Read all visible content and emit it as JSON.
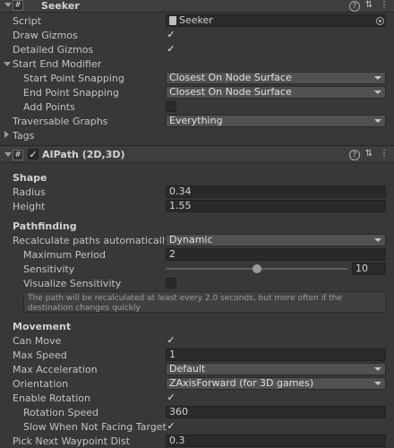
{
  "seeker": {
    "title": "Seeker",
    "script_label": "Script",
    "script_value": "Seeker",
    "draw_gizmos_label": "Draw Gizmos",
    "draw_gizmos": true,
    "detailed_gizmos_label": "Detailed Gizmos",
    "detailed_gizmos": true,
    "start_end_modifier_label": "Start End Modifier",
    "start_point_snapping_label": "Start Point Snapping",
    "start_point_snapping_value": "Closest On Node Surface",
    "end_point_snapping_label": "End Point Snapping",
    "end_point_snapping_value": "Closest On Node Surface",
    "add_points_label": "Add Points",
    "add_points": false,
    "traversable_graphs_label": "Traversable Graphs",
    "traversable_graphs_value": "Everything",
    "tags_label": "Tags"
  },
  "aipath": {
    "title": "AIPath (2D,3D)",
    "enabled": true,
    "shape_header": "Shape",
    "radius_label": "Radius",
    "radius_value": "0.34",
    "height_label": "Height",
    "height_value": "1.55",
    "pathfinding_header": "Pathfinding",
    "recalc_label": "Recalculate paths automatically",
    "recalc_value": "Dynamic",
    "max_period_label": "Maximum Period",
    "max_period_value": "2",
    "sensitivity_label": "Sensitivity",
    "sensitivity_value": "10",
    "sensitivity_fraction": 0.5,
    "visualize_label": "Visualize Sensitivity",
    "visualize": false,
    "help_text": "The path will be recalculated at least every 2.0 seconds, but more often if the destination changes quickly",
    "movement_header": "Movement",
    "can_move_label": "Can Move",
    "can_move": true,
    "max_speed_label": "Max Speed",
    "max_speed_value": "1",
    "max_accel_label": "Max Acceleration",
    "max_accel_value": "Default",
    "orientation_label": "Orientation",
    "orientation_value": "ZAxisForward (for 3D games)",
    "enable_rotation_label": "Enable Rotation",
    "enable_rotation": true,
    "rotation_speed_label": "Rotation Speed",
    "rotation_speed_value": "360",
    "slow_label": "Slow When Not Facing Target",
    "slow": true,
    "pick_next_label": "Pick Next Waypoint Dist",
    "pick_next_value": "0.3"
  },
  "icons": {
    "script": "script-icon",
    "help": "help-icon",
    "settings": "settings-sliders-icon",
    "menu": "kebab-menu-icon",
    "checkmark": "checkmark-icon",
    "object_picker": "object-picker-icon"
  },
  "header_icons": {
    "help": "?",
    "settings": "⇅",
    "menu": "⋮",
    "check": "✓"
  }
}
